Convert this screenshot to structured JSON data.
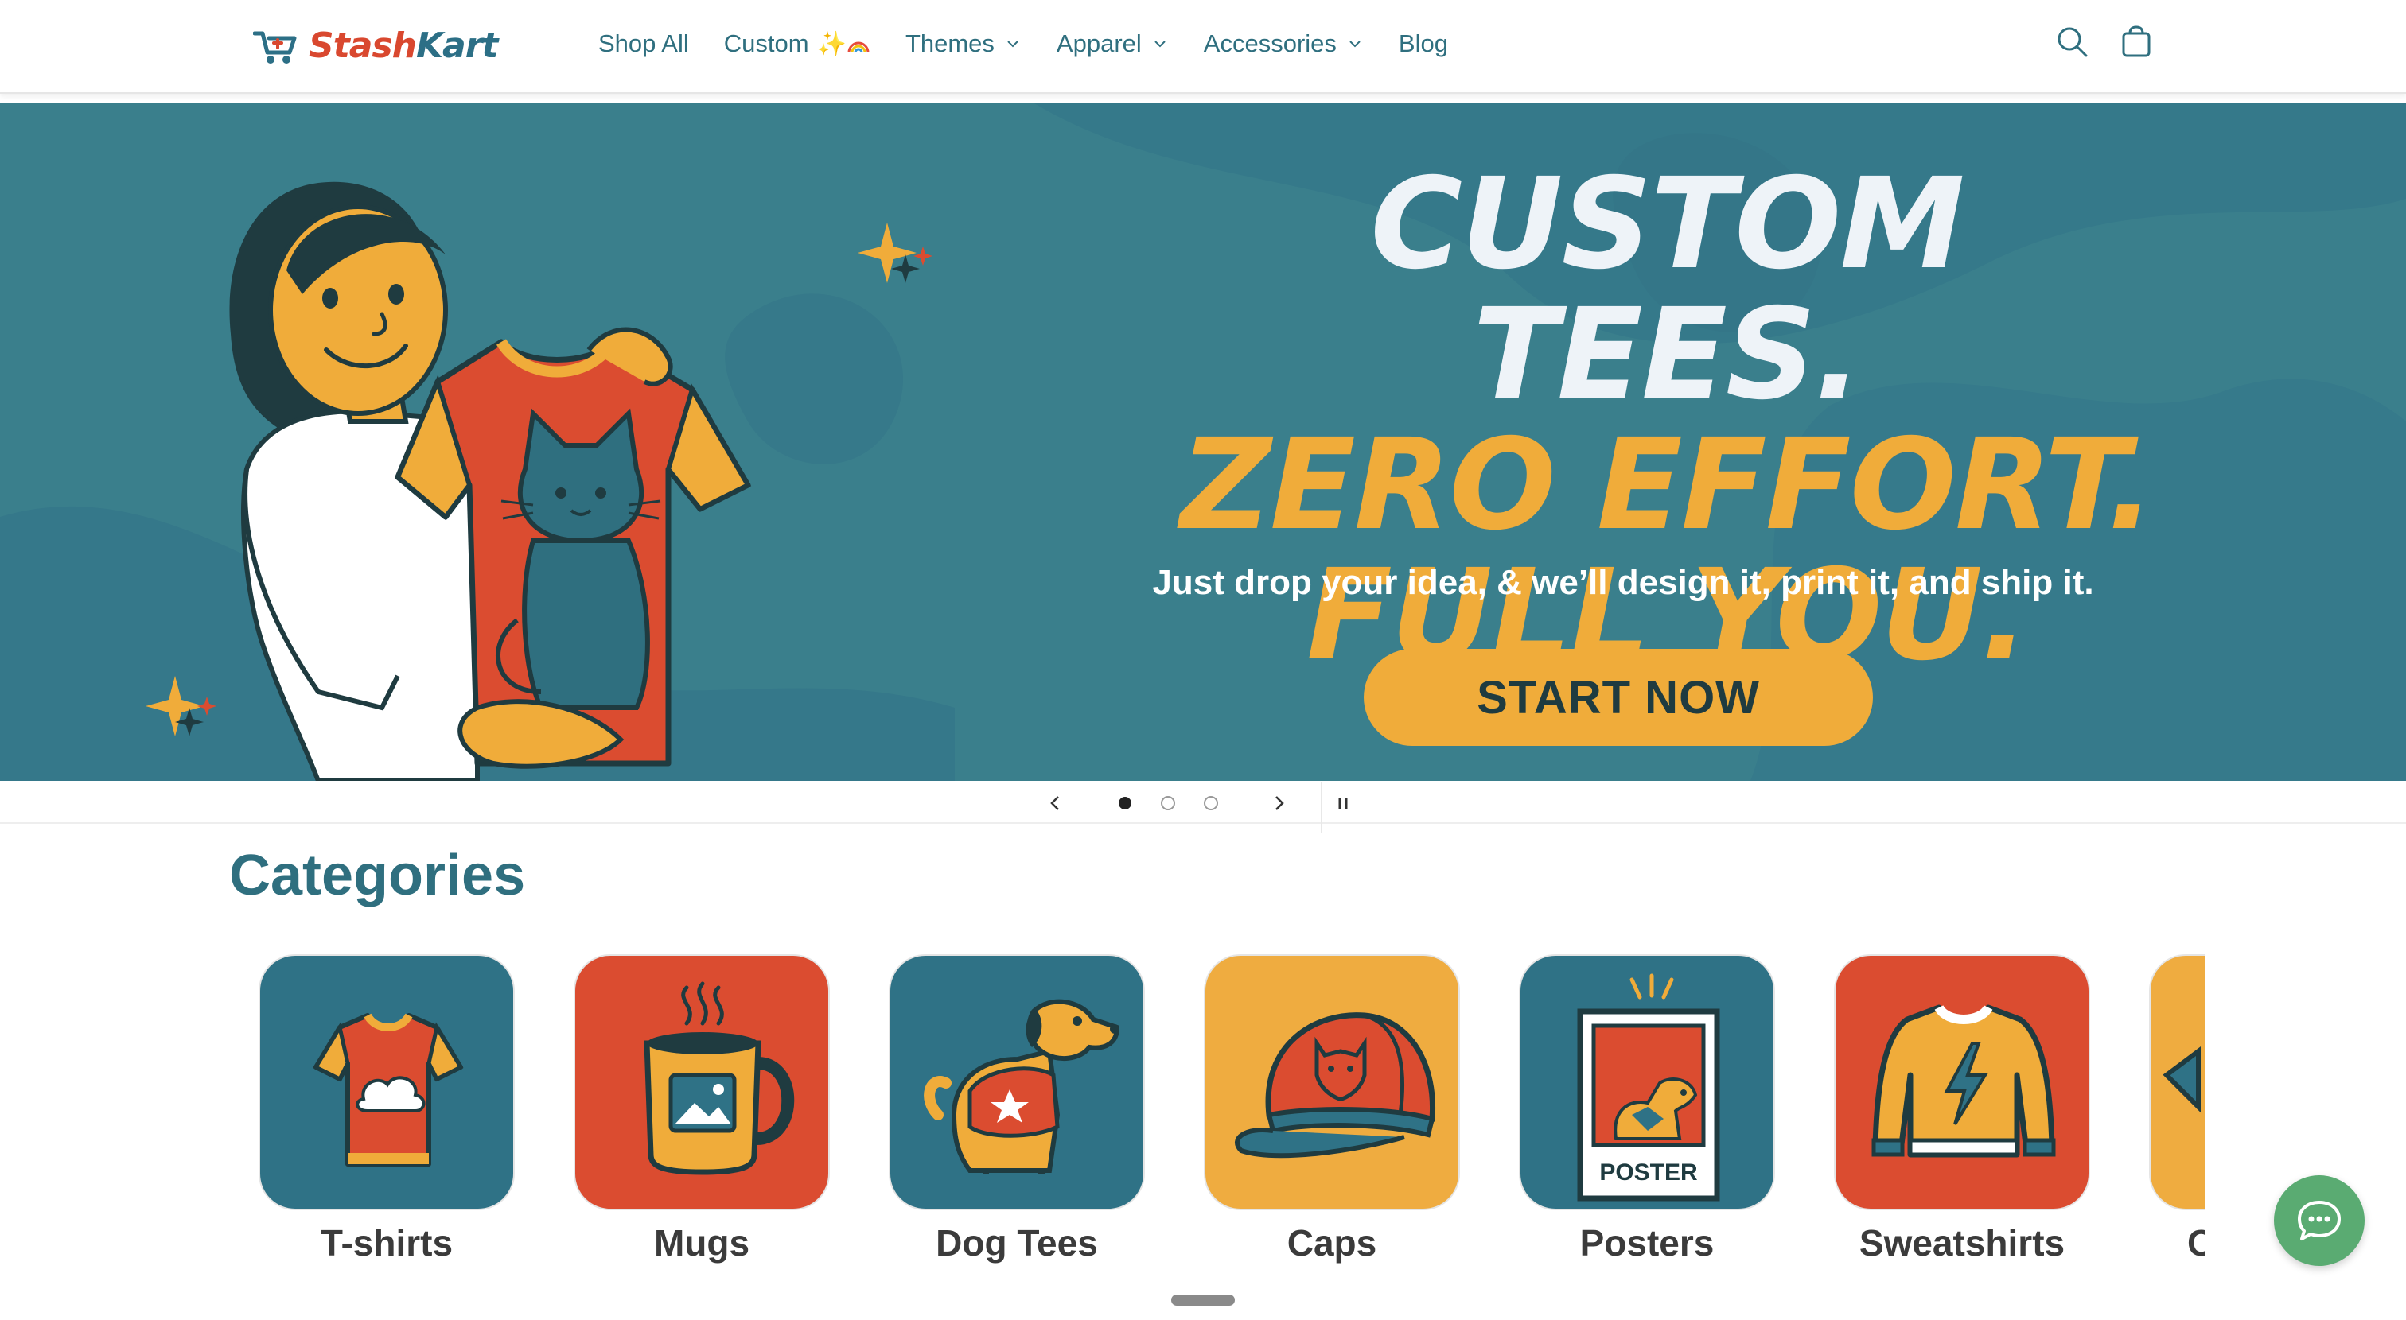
{
  "brand": {
    "name_part1": "Stash",
    "name_part2": "Kart",
    "color_primary": "#d9482f",
    "color_secondary": "#2c6f86"
  },
  "nav": {
    "items": [
      {
        "label": "Shop All",
        "dropdown": false
      },
      {
        "label": "Custom",
        "dropdown": false,
        "sparkles": "✨🌈"
      },
      {
        "label": "Themes",
        "dropdown": true
      },
      {
        "label": "Apparel",
        "dropdown": true
      },
      {
        "label": "Accessories",
        "dropdown": true
      },
      {
        "label": "Blog",
        "dropdown": false
      }
    ],
    "icons": [
      "search-icon",
      "cart-icon"
    ]
  },
  "hero": {
    "line1": "CUSTOM TEES.",
    "line2": "ZERO EFFORT.",
    "line3": "FULL YOU.",
    "subtitle": "Just drop your idea, & we’ll design it, print it, and ship it.",
    "cta": "START NOW",
    "bg_color": "#3a7f8c",
    "accent_color": "#f0ac3a"
  },
  "slider": {
    "slide_count": 3,
    "active_index": 0
  },
  "categories": {
    "title": "Categories",
    "items": [
      {
        "label": "T-shirts",
        "tile_color": "#2f7286"
      },
      {
        "label": "Mugs",
        "tile_color": "#db4c30"
      },
      {
        "label": "Dog Tees",
        "tile_color": "#2f7286"
      },
      {
        "label": "Caps",
        "tile_color": "#efac40"
      },
      {
        "label": "Posters",
        "tile_color": "#2f7286"
      },
      {
        "label": "Sweatshirts",
        "tile_color": "#db4c30"
      },
      {
        "label": "C",
        "tile_color": "#efac40"
      }
    ],
    "poster_text": "POSTER"
  }
}
